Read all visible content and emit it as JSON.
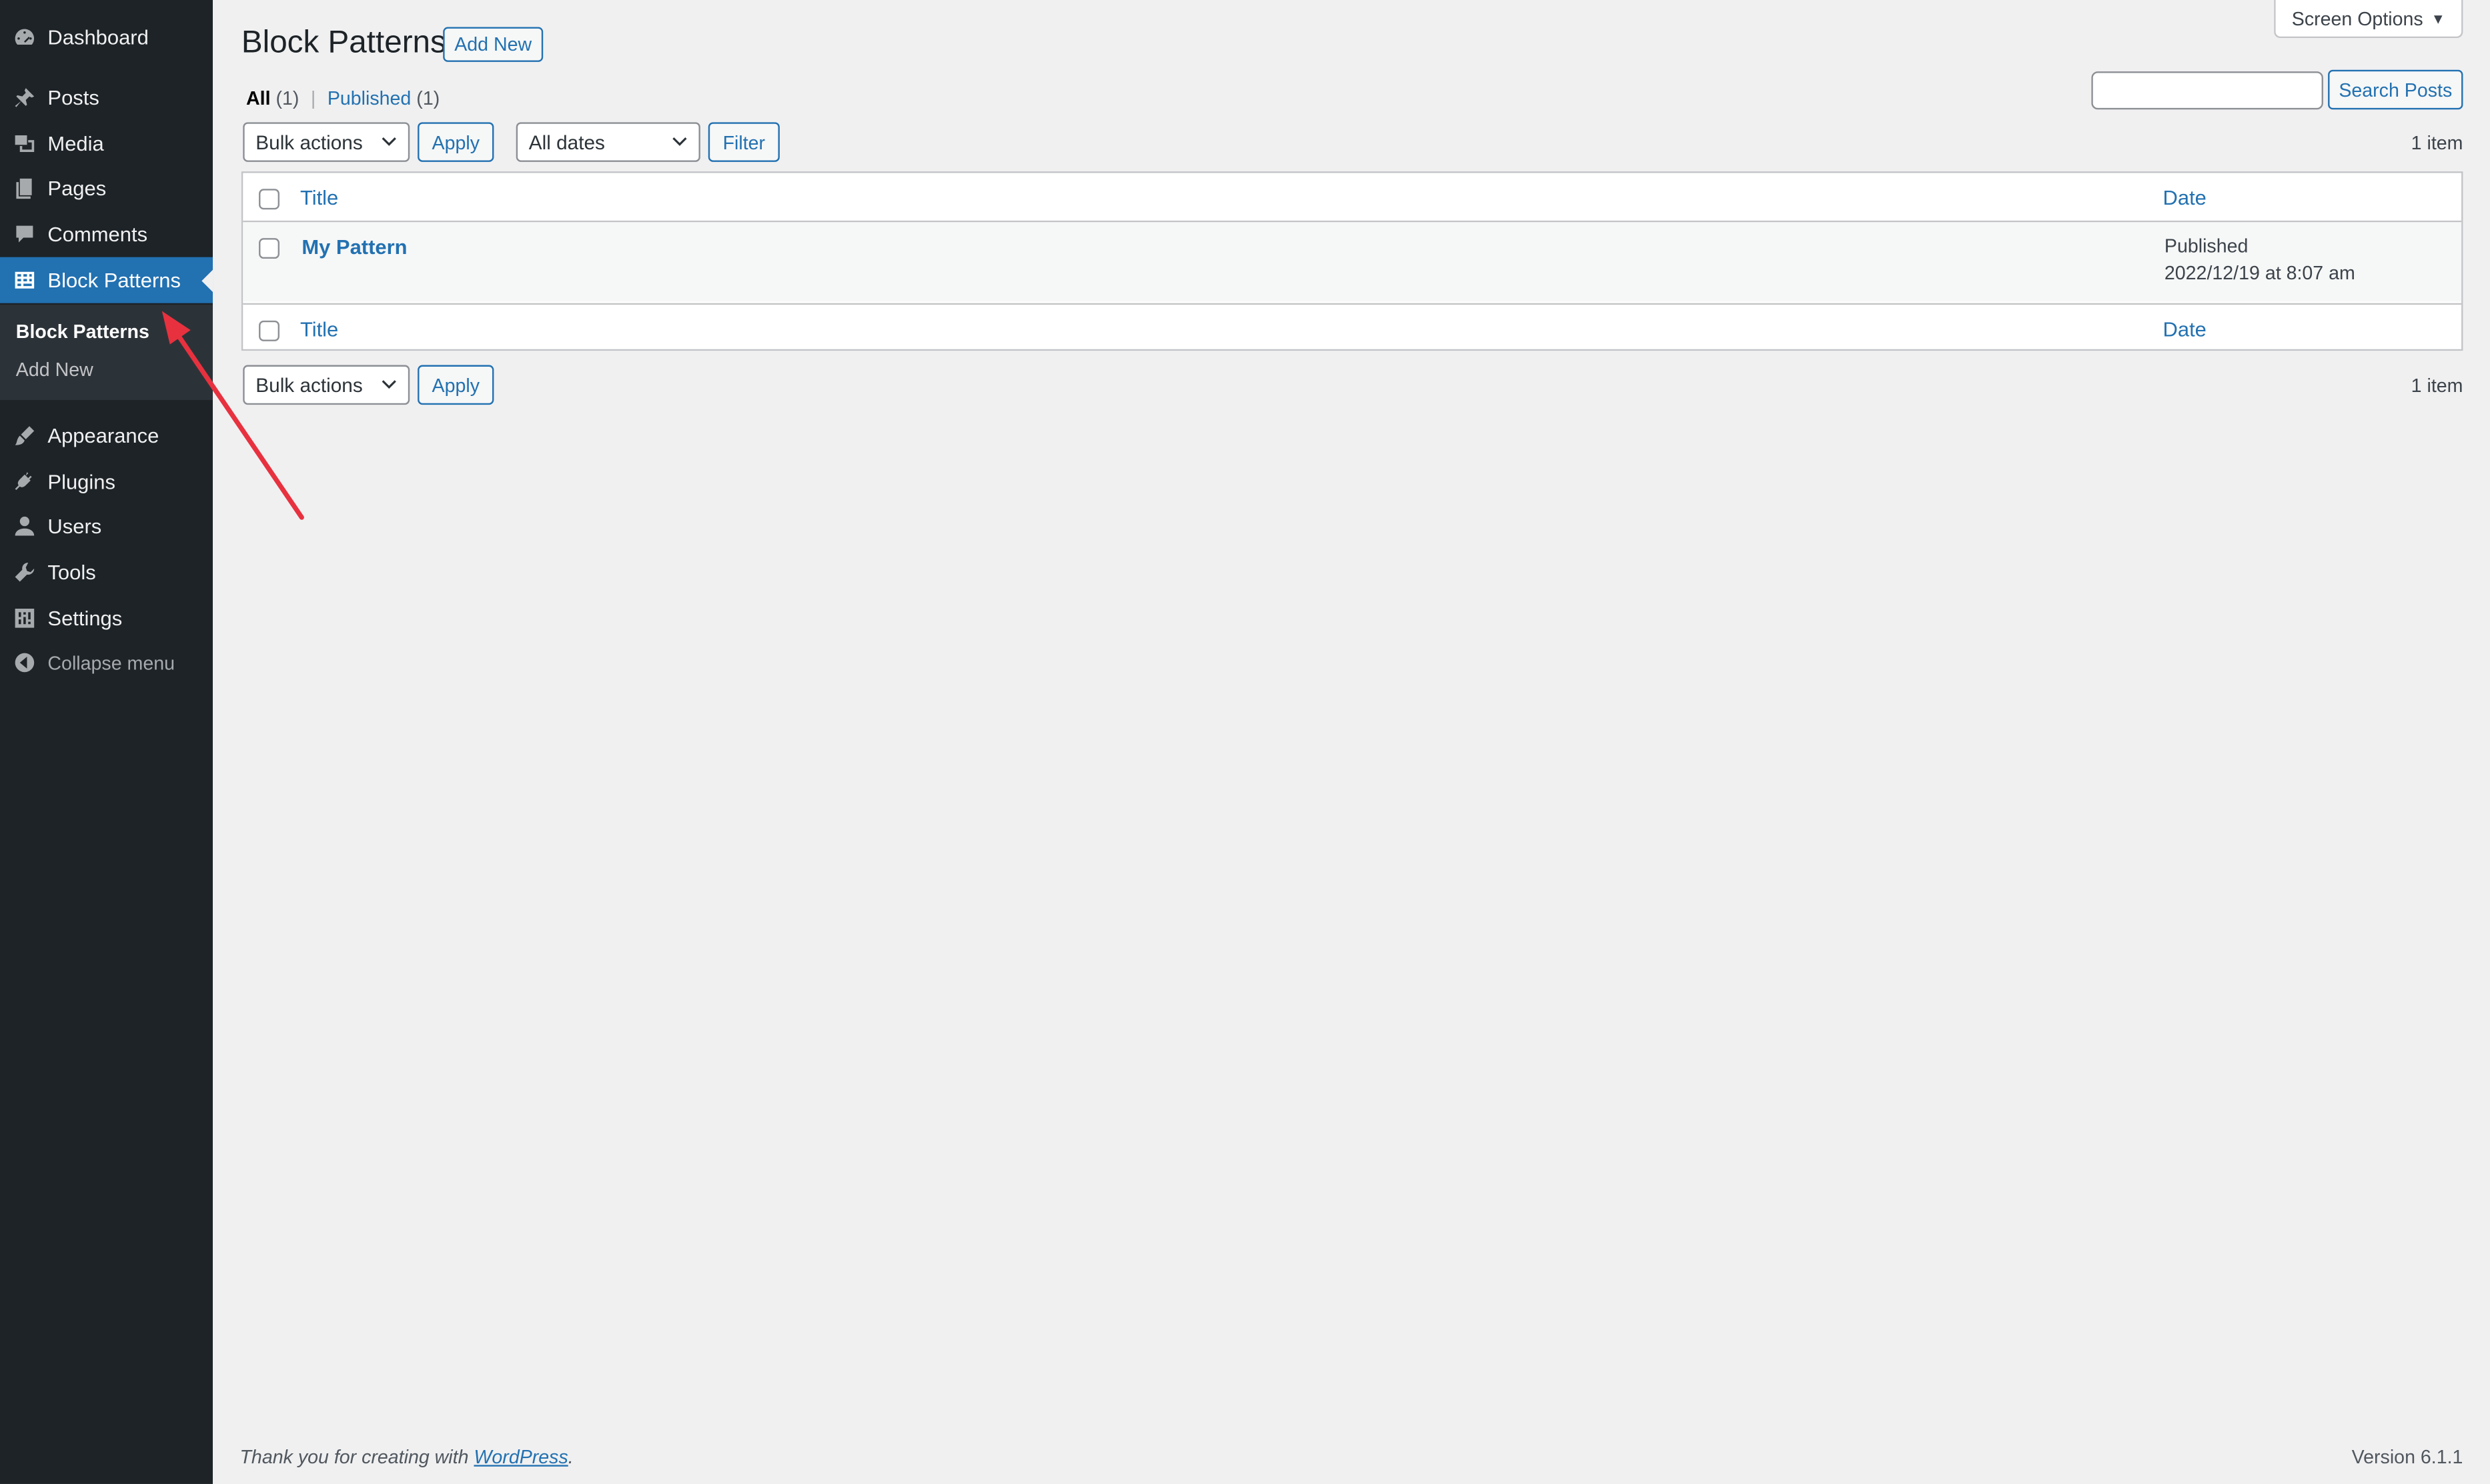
{
  "sidebar": {
    "items": [
      {
        "label": "Dashboard",
        "icon": "dashboard-icon"
      },
      {
        "label": "Posts",
        "icon": "pin-icon"
      },
      {
        "label": "Media",
        "icon": "media-icon"
      },
      {
        "label": "Pages",
        "icon": "pages-icon"
      },
      {
        "label": "Comments",
        "icon": "comment-icon"
      },
      {
        "label": "Block Patterns",
        "icon": "layout-grid-icon",
        "active": true
      },
      {
        "label": "Appearance",
        "icon": "brush-icon"
      },
      {
        "label": "Plugins",
        "icon": "plug-icon"
      },
      {
        "label": "Users",
        "icon": "user-icon"
      },
      {
        "label": "Tools",
        "icon": "wrench-icon"
      },
      {
        "label": "Settings",
        "icon": "settings-icon"
      }
    ],
    "submenu": [
      {
        "label": "Block Patterns",
        "current": true
      },
      {
        "label": "Add New",
        "current": false
      }
    ],
    "collapse_label": "Collapse menu",
    "active_color": "#2271b1",
    "background_color": "#1d2327"
  },
  "header": {
    "title": "Block Patterns",
    "add_new_label": "Add New",
    "screen_options_label": "Screen Options"
  },
  "views": {
    "all_label": "All",
    "all_count": "(1)",
    "separator": "|",
    "published_label": "Published",
    "published_count": "(1)"
  },
  "search": {
    "value": "",
    "button_label": "Search Posts"
  },
  "tablenav_top": {
    "bulk_actions": "Bulk actions",
    "apply_label": "Apply",
    "dates": "All dates",
    "filter_label": "Filter",
    "count": "1 item"
  },
  "table": {
    "columns": {
      "title": "Title",
      "date": "Date"
    },
    "rows": [
      {
        "title": "My Pattern",
        "status": "Published",
        "date": "2022/12/19 at 8:07 am"
      }
    ]
  },
  "tablenav_bottom": {
    "bulk_actions": "Bulk actions",
    "apply_label": "Apply",
    "count": "1 item"
  },
  "footer": {
    "thanks_prefix": "Thank you for creating with",
    "wordpress_link": "WordPress",
    "thanks_suffix": ".",
    "version": "Version 6.1.1"
  },
  "annotation": {
    "arrow_color": "#e8313f"
  }
}
